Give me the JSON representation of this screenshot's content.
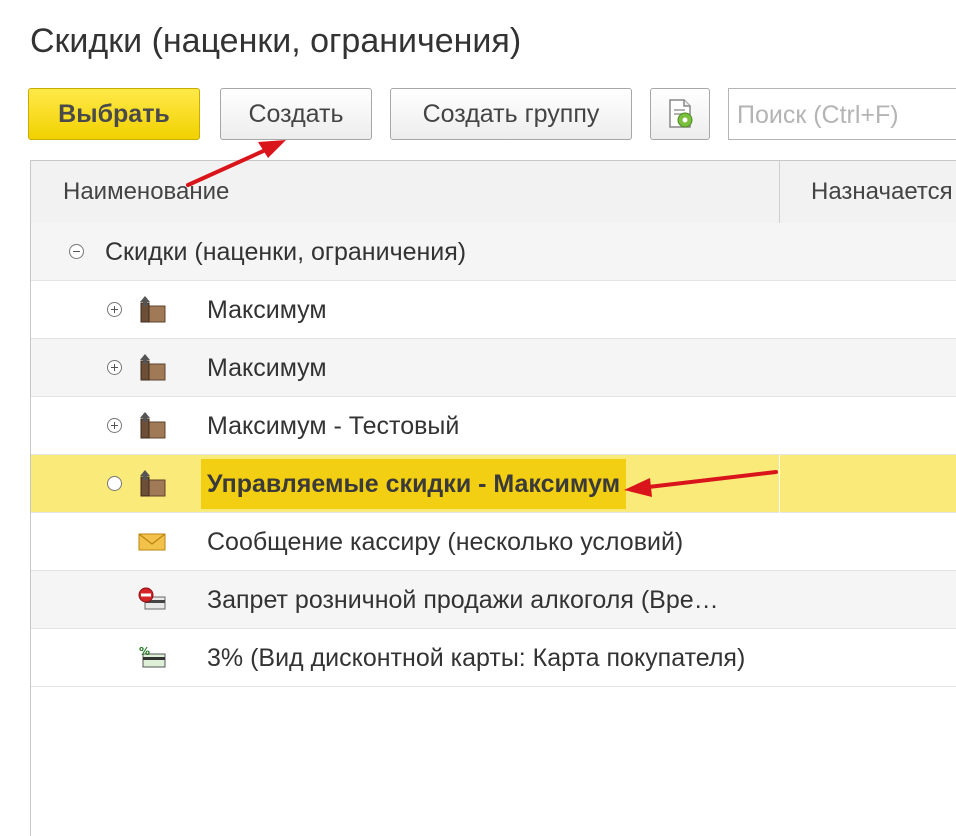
{
  "window": {
    "title": "Скидки (наценки, ограничения)"
  },
  "toolbar": {
    "select_label": "Выбрать",
    "create_label": "Создать",
    "create_group_label": "Создать группу",
    "settings_icon": "list-settings-icon"
  },
  "search": {
    "placeholder": "Поиск (Ctrl+F)"
  },
  "table": {
    "columns": [
      "Наименование",
      "Назначается"
    ],
    "root": {
      "label": "Скидки (наценки, ограничения)",
      "toggle": "collapse"
    },
    "rows": [
      {
        "label": "Максимум",
        "toggle": "expand",
        "icon": "folder-up-icon"
      },
      {
        "label": "Максимум",
        "toggle": "expand",
        "icon": "folder-up-icon"
      },
      {
        "label": "Максимум - Тестовый",
        "toggle": "expand",
        "icon": "folder-up-icon"
      },
      {
        "label": "Управляемые скидки - Максимум",
        "toggle": "empty",
        "icon": "folder-up-icon",
        "selected": true
      },
      {
        "label": "Сообщение кассиру (несколько условий)",
        "icon": "envelope-icon"
      },
      {
        "label": "Запрет розничной продажи алкоголя (Вре…",
        "icon": "prohibited-icon"
      },
      {
        "label": "3% (Вид дисконтной карты: Карта покупателя)",
        "icon": "discount-card-icon"
      }
    ]
  },
  "colors": {
    "primary_button": "#f1d100",
    "selected_row": "#f9ea79",
    "selected_highlight": "#f2cf12",
    "annotation_arrow": "#d9141b"
  }
}
